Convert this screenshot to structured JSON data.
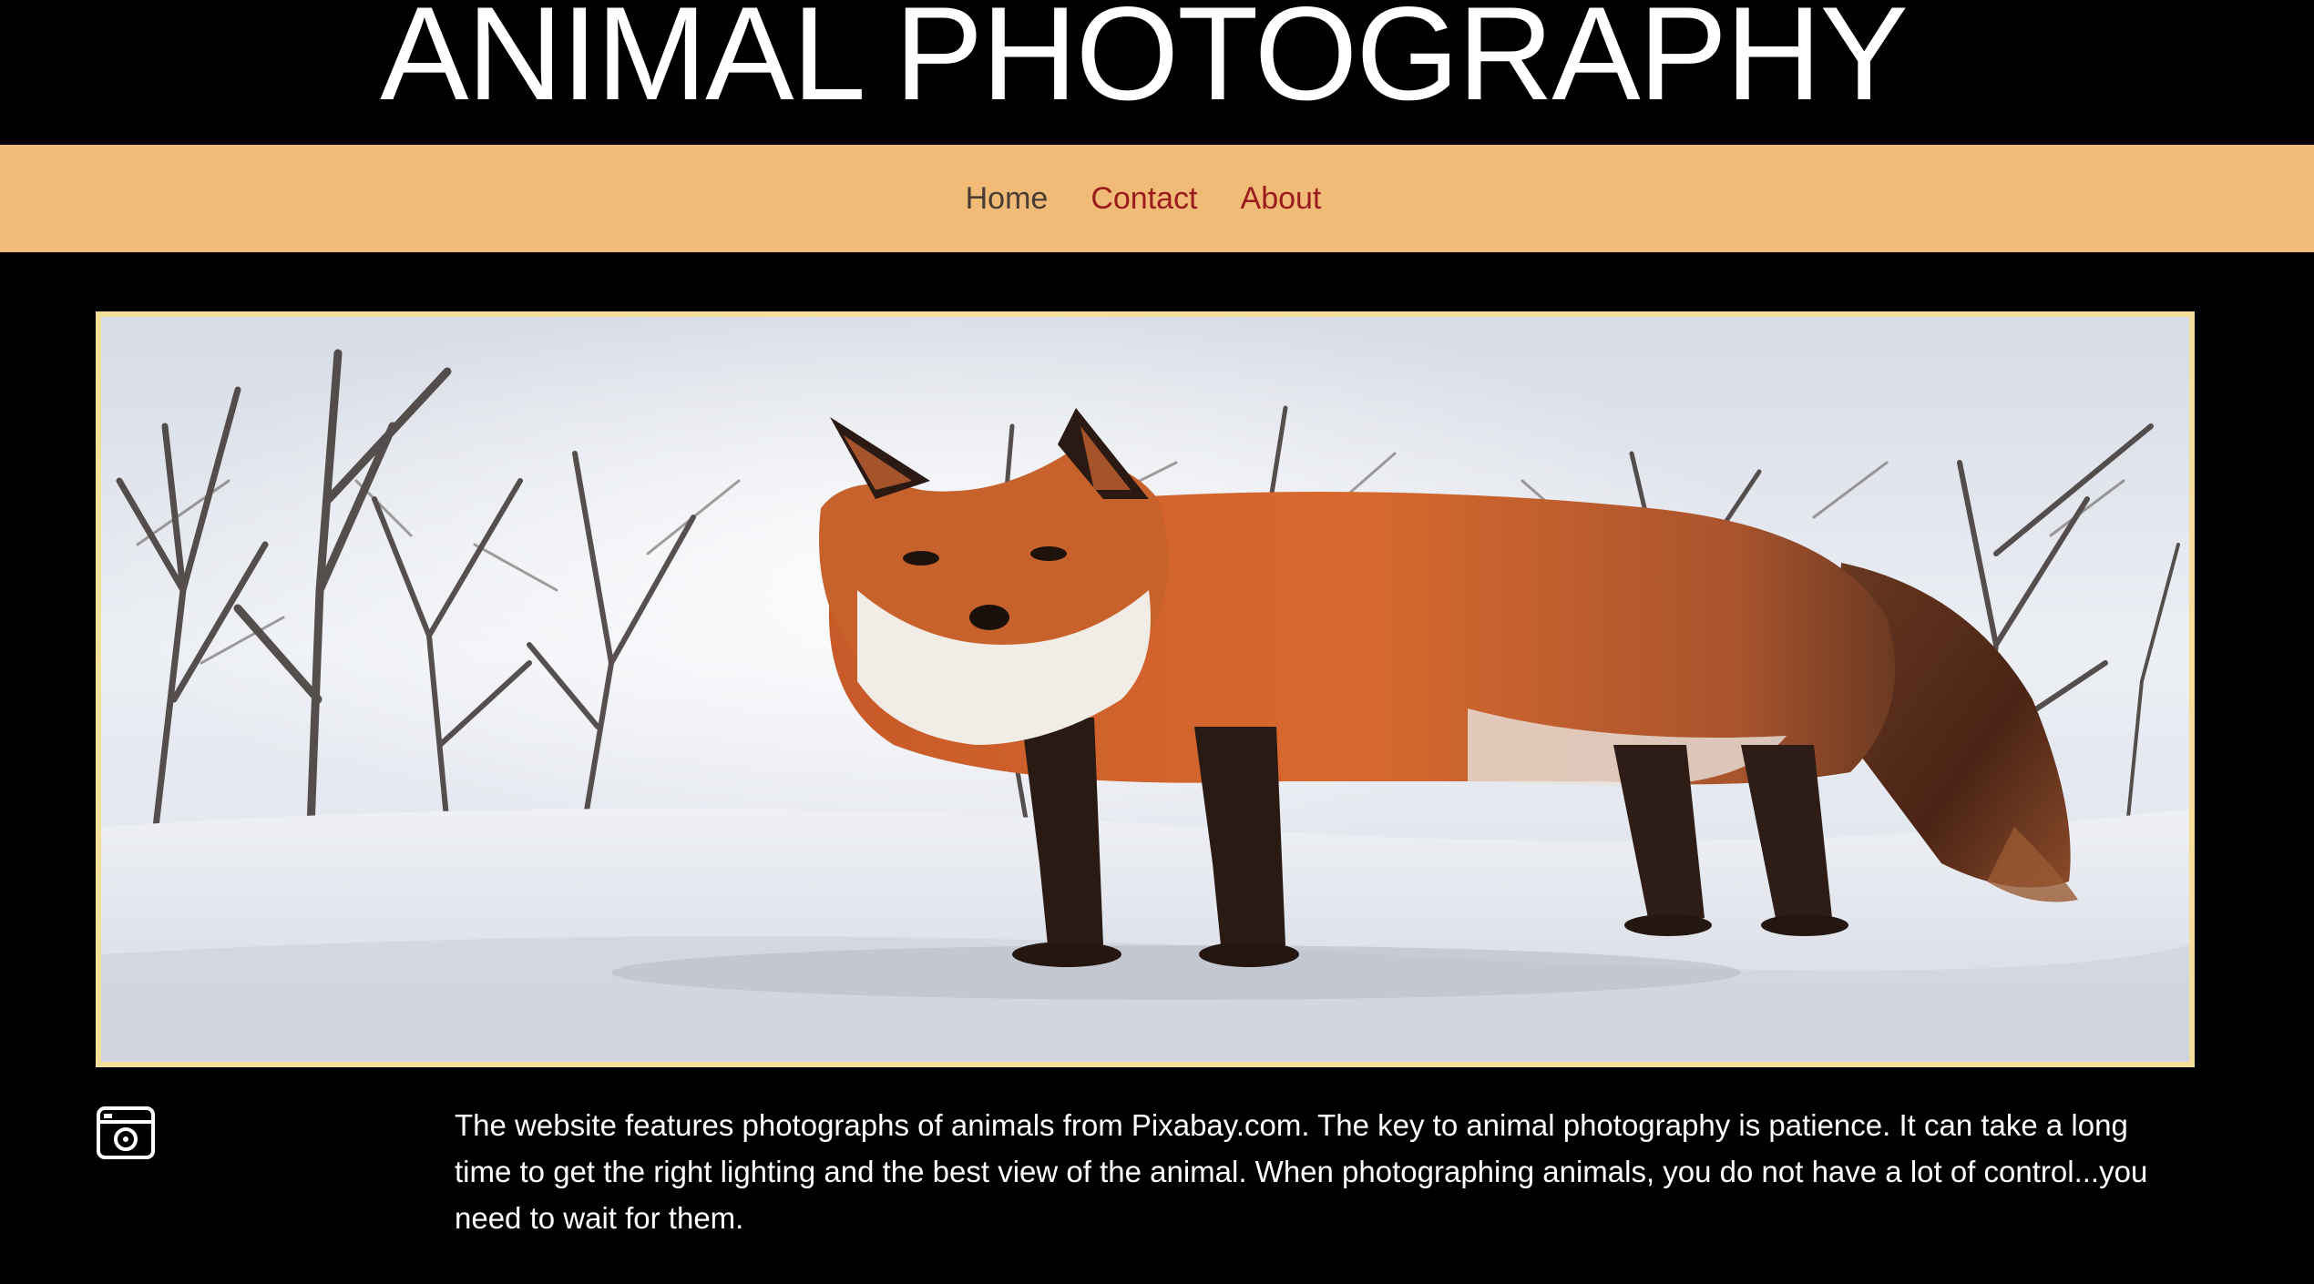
{
  "header": {
    "title": "ANIMAL PHOTOGRAPHY"
  },
  "nav": {
    "items": [
      {
        "label": "Home",
        "current": true
      },
      {
        "label": "Contact",
        "current": false
      },
      {
        "label": "About",
        "current": false
      }
    ]
  },
  "hero": {
    "subject": "red fox standing in snow among bare trees",
    "frame_color": "#f3df9a"
  },
  "content": {
    "icon": "camera-icon",
    "paragraph": "The website features photographs of animals from Pixabay.com. The key to animal photography is patience. It can take a long time to get the right lighting and the best view of the animal. When photographing animals, you do not have a lot of control...you need to wait for them."
  },
  "colors": {
    "background": "#000000",
    "nav_background": "#f0bb77",
    "nav_current": "#4a3c34",
    "nav_link": "#9a1b1b",
    "text": "#ffffff"
  }
}
